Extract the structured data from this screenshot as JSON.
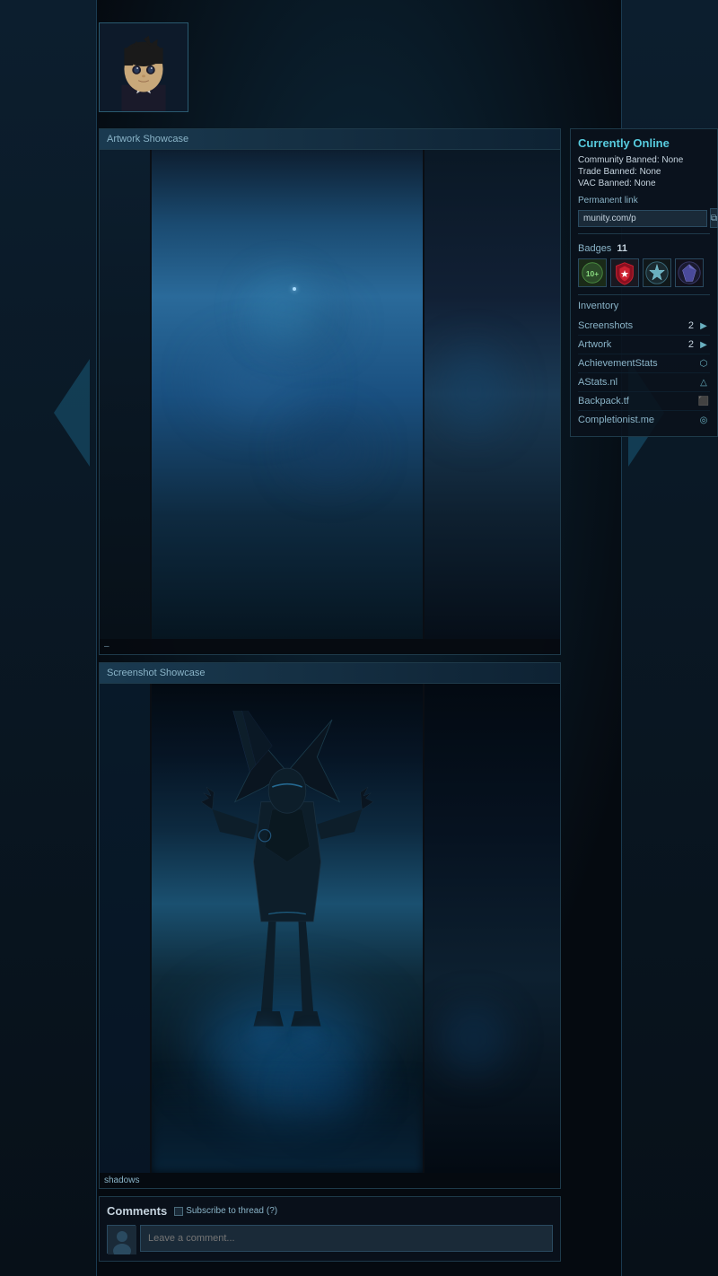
{
  "page": {
    "background_color": "#0a0e14"
  },
  "profile": {
    "avatar_alt": "anime character avatar",
    "username": ""
  },
  "status": {
    "label": "Currently Online",
    "community_banned_label": "Community Banned:",
    "community_banned_value": "None",
    "trade_banned_label": "Trade Banned:",
    "trade_banned_value": "None",
    "vac_banned_label": "VAC Banned:",
    "vac_banned_value": "None",
    "permanent_link_label": "Permanent link",
    "permanent_link_value": "munity.com/p",
    "copy_button_label": "⧉"
  },
  "badges": {
    "label": "Badges",
    "count": "11",
    "items": [
      {
        "id": "badge-years",
        "tooltip": "Years of Service 10+"
      },
      {
        "id": "badge-shield",
        "tooltip": "Shield Badge"
      },
      {
        "id": "badge-star",
        "tooltip": "Star Badge"
      },
      {
        "id": "badge-gem",
        "tooltip": "Gem Badge"
      }
    ]
  },
  "inventory": {
    "label": "Inventory"
  },
  "links": [
    {
      "label": "Screenshots",
      "value": "2",
      "icon": "screenshot-icon"
    },
    {
      "label": "Artwork",
      "value": "2",
      "icon": "artwork-icon"
    },
    {
      "label": "AchievementStats",
      "icon": "achievement-icon"
    },
    {
      "label": "AStats.nl",
      "icon": "astats-icon"
    },
    {
      "label": "Backpack.tf",
      "icon": "backpack-icon"
    },
    {
      "label": "Completionist.me",
      "icon": "completionist-icon"
    }
  ],
  "artwork_showcase": {
    "title": "Artwork Showcase",
    "caption": "–"
  },
  "screenshot_showcase": {
    "title": "Screenshot Showcase",
    "caption": "shadows"
  },
  "comments": {
    "title": "Comments",
    "subscribe_label": "Subscribe to thread",
    "subscribe_count": "(?)",
    "placeholder": "Leave a comment..."
  }
}
